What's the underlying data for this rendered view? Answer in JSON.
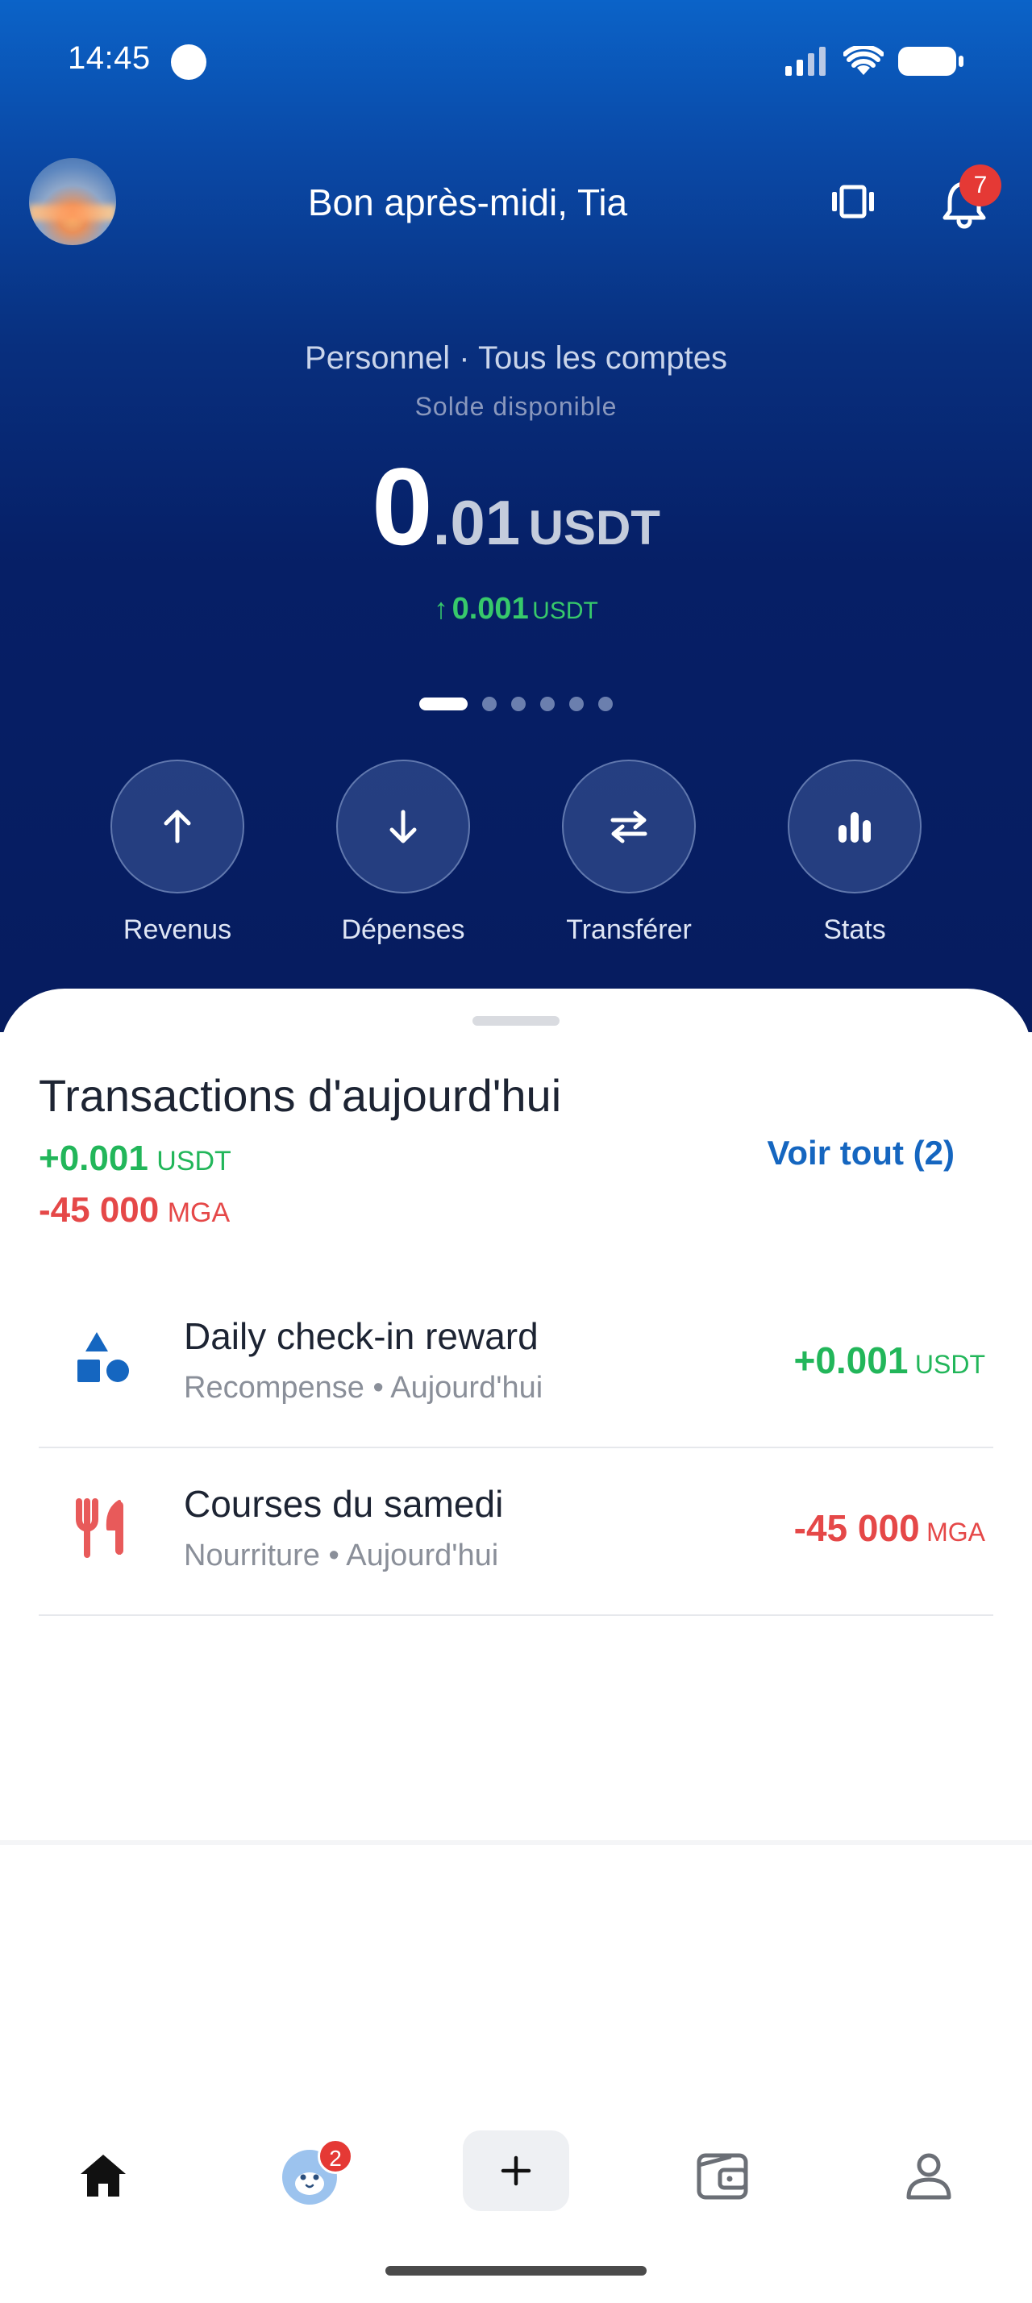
{
  "status_bar": {
    "time": "14:45"
  },
  "header": {
    "greeting": "Bon après-midi, Tia",
    "notification_count": "7"
  },
  "balance": {
    "account_line": "Personnel · Tous les comptes",
    "label": "Solde disponible",
    "integer": "0",
    "decimal": ".01",
    "currency": "USDT",
    "delta_arrow": "↑",
    "delta_value": "0.001",
    "delta_currency": "USDT"
  },
  "pager": {
    "pages": 6,
    "active": 0
  },
  "actions": [
    {
      "label": "Revenus",
      "icon": "arrow-up-icon"
    },
    {
      "label": "Dépenses",
      "icon": "arrow-down-icon"
    },
    {
      "label": "Transférer",
      "icon": "transfer-icon"
    },
    {
      "label": "Stats",
      "icon": "stats-icon"
    }
  ],
  "transactions": {
    "title": "Transactions d'aujourd'hui",
    "total_usdt_value": "+0.001",
    "total_usdt_currency": "USDT",
    "total_mga_value": "-45 000",
    "total_mga_currency": "MGA",
    "see_all": "Voir tout (2)",
    "items": [
      {
        "name": "Daily check-in reward",
        "subtitle": "Recompense • Aujourd'hui",
        "amount": "+0.001",
        "currency": "USDT",
        "icon": "shapes-icon"
      },
      {
        "name": "Courses du samedi",
        "subtitle": "Nourriture • Aujourd'hui",
        "amount": "-45 000",
        "currency": "MGA",
        "icon": "utensils-icon"
      }
    ]
  },
  "bottom_nav": {
    "items": [
      "home-icon",
      "pet-icon",
      "add-icon",
      "wallet-icon",
      "profile-icon"
    ],
    "pet_badge": "2"
  },
  "colors": {
    "accent": "#1566c0",
    "positive": "#22b65a",
    "negative": "#e54848",
    "badge": "#e53935"
  }
}
